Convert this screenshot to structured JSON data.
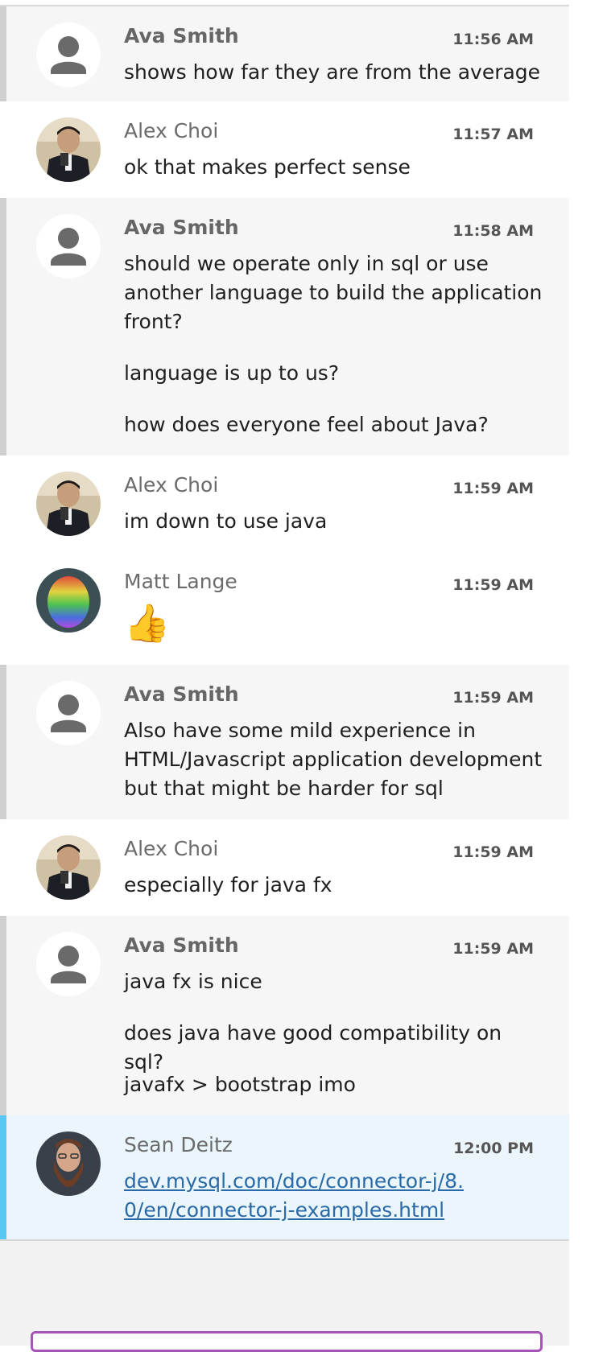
{
  "messages": [
    {
      "author": "Ava Smith",
      "time": "11:56 AM",
      "lines": [
        "shows how far they are from the average"
      ]
    },
    {
      "author": "Alex Choi",
      "time": "11:57 AM",
      "lines": [
        "ok that makes perfect sense"
      ]
    },
    {
      "author": "Ava Smith",
      "time": "11:58 AM",
      "lines": [
        "should we operate only in sql or use another language to build the application front?",
        "language is up to us?",
        "how does everyone feel about Java?"
      ]
    },
    {
      "author": "Alex Choi",
      "time": "11:59 AM",
      "lines": [
        "im down to use java"
      ]
    },
    {
      "author": "Matt Lange",
      "time": "11:59 AM",
      "emoji": "👍"
    },
    {
      "author": "Ava Smith",
      "time": "11:59 AM",
      "lines": [
        "Also have some mild experience in HTML/Javascript application development but that might be harder for sql"
      ]
    },
    {
      "author": "Alex Choi",
      "time": "11:59 AM",
      "lines": [
        "especially for java fx"
      ]
    },
    {
      "author": "Ava Smith",
      "time": "11:59 AM",
      "lines": [
        "java fx is nice",
        "does java have good compatibility on sql?",
        "javafx > bootstrap imo"
      ]
    },
    {
      "author": "Sean Deitz",
      "time": "12:00 PM",
      "link": "dev.mysql.com/doc/connector-j/8.0/en/connector-j-examples.html"
    }
  ],
  "colors": {
    "self_bar": "#d0d0d0",
    "highlight_bar": "#58c7f1",
    "link": "#2a6aa8",
    "composer_border": "#a653b8"
  }
}
